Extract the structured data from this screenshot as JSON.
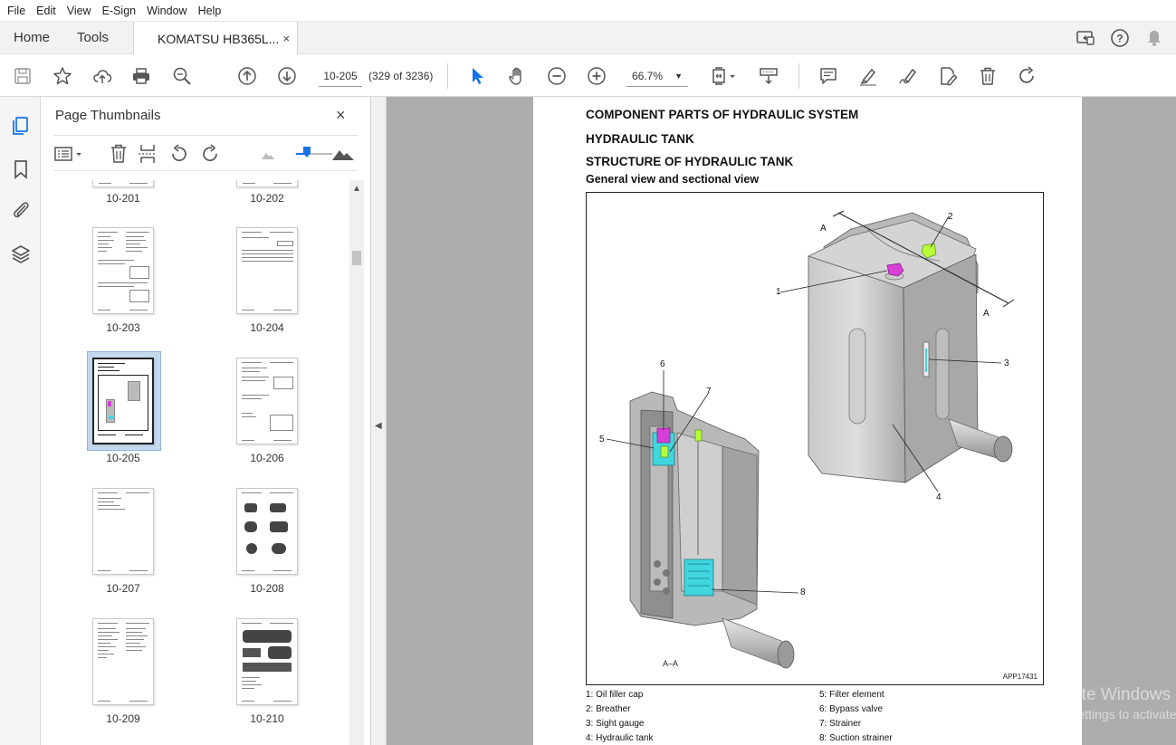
{
  "menu": [
    "File",
    "Edit",
    "View",
    "E-Sign",
    "Window",
    "Help"
  ],
  "tabs": {
    "home": "Home",
    "tools": "Tools",
    "document": "KOMATSU HB365L...",
    "close": "×"
  },
  "toolbar": {
    "page_value": "10-205",
    "page_count": "(329 of 3236)",
    "zoom_value": "66.7%"
  },
  "panel": {
    "title": "Page Thumbnails",
    "close": "×"
  },
  "thumbnails": [
    "10-201",
    "10-202",
    "10-203",
    "10-204",
    "10-205",
    "10-206",
    "10-207",
    "10-208",
    "10-209",
    "10-210"
  ],
  "selected_thumbnail": "10-205",
  "document": {
    "heading1": "COMPONENT PARTS OF HYDRAULIC SYSTEM",
    "heading2": "HYDRAULIC TANK",
    "heading3": "STRUCTURE OF HYDRAULIC TANK",
    "heading4": "General view and sectional view",
    "figure_code": "APP17431",
    "section_label": "A–A",
    "cut_label_a": "A",
    "callouts": [
      "1",
      "2",
      "3",
      "4",
      "5",
      "6",
      "7",
      "8"
    ],
    "legend_left": [
      "1: Oil filler cap",
      "2: Breather",
      "3: Sight gauge",
      "4: Hydraulic tank"
    ],
    "legend_right": [
      "5: Filter element",
      "6: Bypass valve",
      "7: Strainer",
      "8: Suction strainer"
    ]
  },
  "watermark": {
    "line1": "Activate Windows",
    "line2": "Go to Settings to activate Windows."
  },
  "colors": {
    "accent": "#1473e6",
    "selection": "#c5d9ee",
    "viewport_bg": "#adadad",
    "highlight_magenta": "#d63fd6",
    "highlight_green": "#b7ff3a",
    "highlight_cyan": "#3fd6e0"
  }
}
